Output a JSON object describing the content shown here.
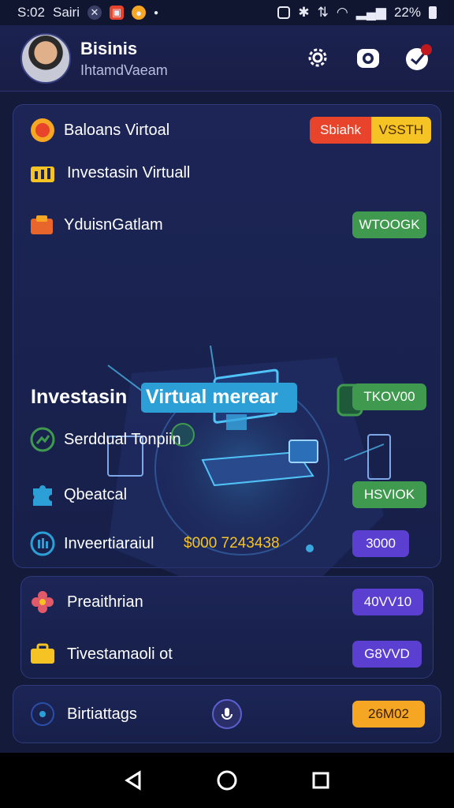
{
  "status_bar": {
    "time": "S:02",
    "carrier": "Sairi",
    "battery": "22%"
  },
  "header": {
    "title": "Bisinis",
    "subtitle": "IhtamdVaeam"
  },
  "main_panel": {
    "rows": [
      {
        "label": "Baloans Virtoal",
        "pill_left": "Sbiahk",
        "pill_right": "VSSTH"
      },
      {
        "label": "Investasin Virtuall"
      },
      {
        "label": "YduisnGatlam",
        "pill": "WTOOGK"
      }
    ],
    "hero_label": "Investasin",
    "hero_highlight": "Virtual merear",
    "hero_pill": "TKOV00",
    "rows2": [
      {
        "label": "Serddual Tonpiin"
      },
      {
        "label": "Qbeatcal",
        "pill": "HSVIOK"
      },
      {
        "label": "Inveertiaraiul",
        "amount": "$000 7243438",
        "pill": "3000"
      }
    ]
  },
  "second_panel": {
    "rows": [
      {
        "label": "Preaithrian",
        "pill": "40VV10"
      },
      {
        "label": "Tivestamaoli ot",
        "pill": "G8VVD"
      }
    ]
  },
  "third_panel": {
    "label": "Birtiattags",
    "pill": "26M02"
  },
  "colors": {
    "green_pill": "#3f9a4f",
    "purple_pill": "#5b3fd0",
    "orange_pill": "#f5a623",
    "red_pill": "#e8432b",
    "highlight": "#2b9fd6"
  }
}
